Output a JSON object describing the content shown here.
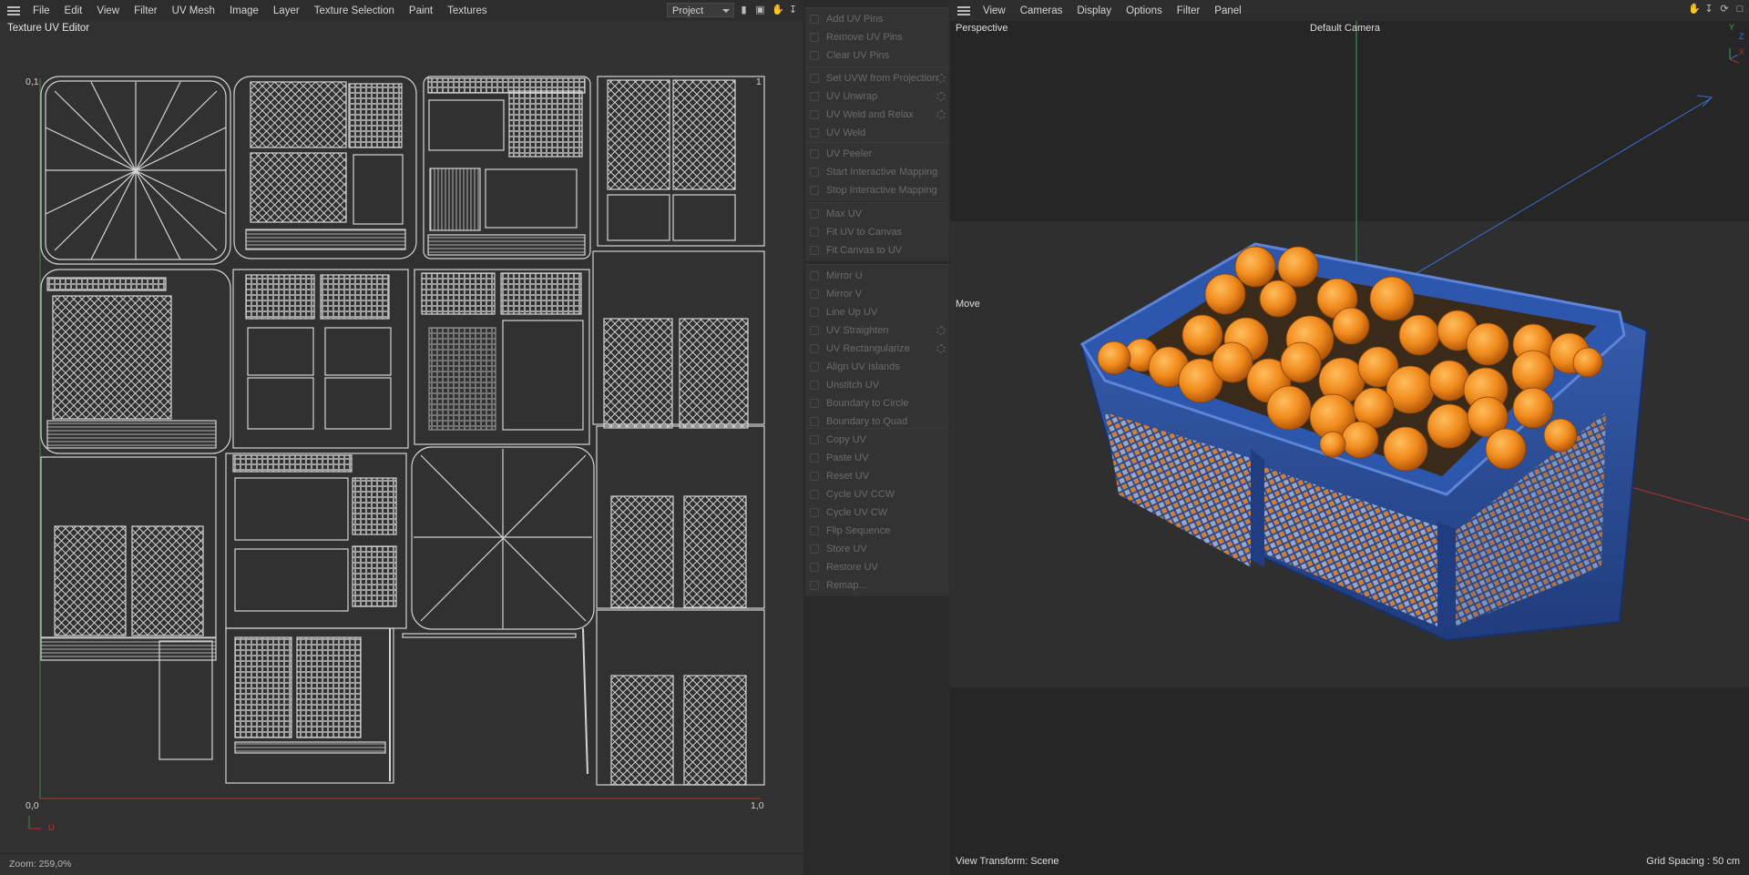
{
  "uv_editor": {
    "menu": [
      "File",
      "Edit",
      "View",
      "Filter",
      "UV Mesh",
      "Image",
      "Layer",
      "Texture Selection",
      "Paint",
      "Textures"
    ],
    "project_dropdown": "Project",
    "title": "Texture UV Editor",
    "corner_top_left": "0,1",
    "corner_top_right": "1",
    "corner_bottom_left": "0,0",
    "corner_bottom_right": "1,0",
    "axis_u": "U",
    "zoom": "Zoom: 259,0%"
  },
  "command_panel": {
    "groups": [
      [
        "Add UV Pins",
        "Remove UV Pins",
        "Clear UV Pins"
      ],
      [
        "Set UVW from Projection",
        "UV Unwrap",
        "UV Weld and Relax",
        "UV Weld"
      ],
      [
        "UV Peeler",
        "Start Interactive Mapping",
        "Stop Interactive Mapping"
      ],
      [
        "Max UV",
        "Fit UV to Canvas",
        "Fit Canvas to UV"
      ],
      [
        "Mirror U",
        "Mirror V",
        "Line Up UV",
        "UV Straighten",
        "UV Rectangularize",
        "Align UV Islands",
        "Unstitch UV",
        "Boundary to Circle",
        "Boundary to Quad"
      ],
      [
        "Copy UV",
        "Paste UV",
        "Reset UV",
        "Cycle UV CCW",
        "Cycle UV CW",
        "Flip Sequence",
        "Store UV",
        "Restore UV",
        "Remap..."
      ]
    ]
  },
  "viewport": {
    "menu": [
      "View",
      "Cameras",
      "Display",
      "Options",
      "Filter",
      "Panel"
    ],
    "projection": "Perspective",
    "camera": "Default Camera",
    "tool": "Move",
    "view_transform": "View Transform: Scene",
    "grid_spacing": "Grid Spacing : 50 cm",
    "axis_labels": [
      "Y",
      "Z",
      "X"
    ]
  },
  "colors": {
    "crate_blue": "#2b4f9e",
    "orange": "#f08a1c",
    "axis_green": "#3fa35a",
    "axis_red": "#b03030",
    "axis_blue": "#3a6fd0"
  }
}
